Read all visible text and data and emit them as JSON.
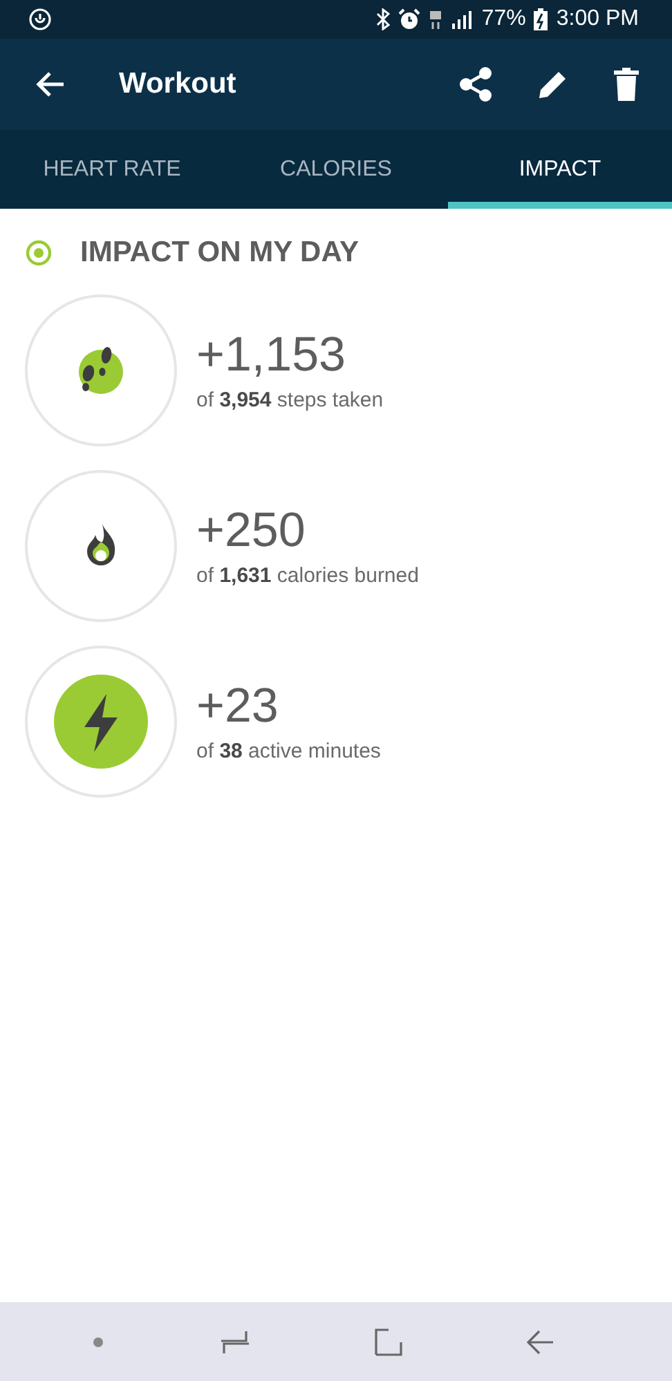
{
  "status_bar": {
    "battery": "77%",
    "time": "3:00 PM"
  },
  "toolbar": {
    "title": "Workout"
  },
  "tabs": [
    {
      "label": "HEART RATE",
      "selected": false
    },
    {
      "label": "CALORIES",
      "selected": false
    },
    {
      "label": "IMPACT",
      "selected": true
    }
  ],
  "section": {
    "title": "IMPACT ON MY DAY"
  },
  "metrics": [
    {
      "kind": "steps",
      "value": "+1,153",
      "caption": "of **3,954** steps taken"
    },
    {
      "kind": "calories",
      "value": "+250",
      "caption": "of **1,631** calories burned"
    },
    {
      "kind": "minutes",
      "value": "+23",
      "caption": "of **38** active minutes"
    }
  ]
}
